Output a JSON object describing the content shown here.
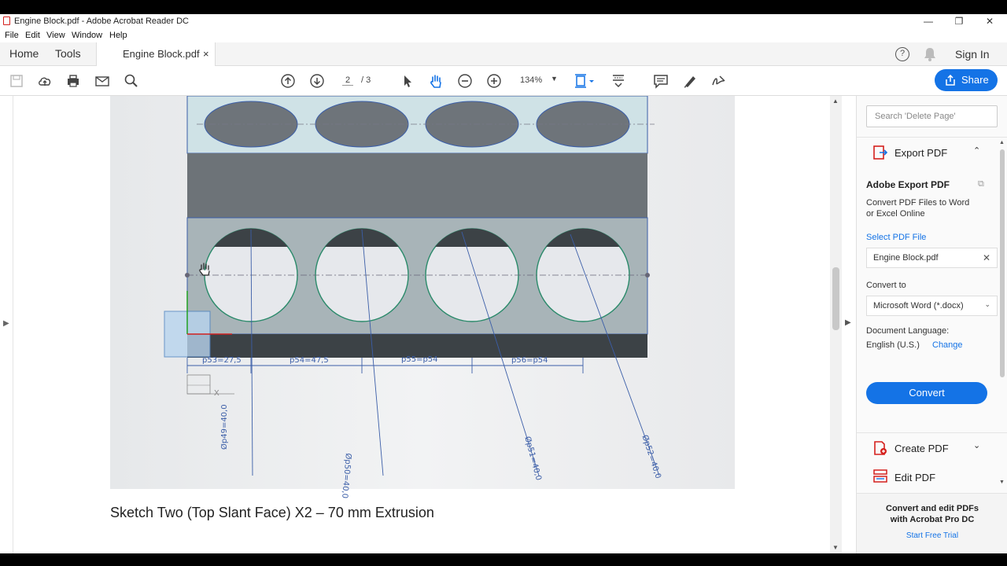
{
  "window": {
    "title": "Engine Block.pdf - Adobe Acrobat Reader DC",
    "minimize": "—",
    "restore": "❐",
    "close": "✕"
  },
  "menu": [
    "File",
    "Edit",
    "View",
    "Window",
    "Help"
  ],
  "tabs": {
    "home": "Home",
    "tools": "Tools",
    "document": "Engine Block.pdf",
    "close": "×"
  },
  "header_right": {
    "sign_in": "Sign In"
  },
  "toolbar": {
    "page_current": "2",
    "page_total": "/ 3",
    "zoom": "134%",
    "share": "Share"
  },
  "document": {
    "caption": "Sketch Two (Top Slant Face) X2 – 70 mm Extrusion",
    "dimensions": [
      "p53=27,5",
      "p54=47,5",
      "p55=p54",
      "p56=p54"
    ],
    "diameters": [
      "Øp49=40,0",
      "Øp50=40,0",
      "Øp51=40,0",
      "Øp52=40,0"
    ],
    "axis_x": "X"
  },
  "right_pane": {
    "search_placeholder": "Search 'Delete Page'",
    "export_title": "Export PDF",
    "adobe_export_title": "Adobe Export PDF",
    "description_line1": "Convert PDF Files to Word",
    "description_line2": "or Excel Online",
    "select_file": "Select PDF File",
    "file_name": "Engine Block.pdf",
    "convert_to": "Convert to",
    "format": "Microsoft Word (*.docx)",
    "doc_lang_label": "Document Language:",
    "doc_lang": "English (U.S.)",
    "change": "Change",
    "convert_button": "Convert",
    "create_pdf": "Create PDF",
    "edit_pdf": "Edit PDF",
    "promo_line1": "Convert and edit PDFs",
    "promo_line2": "with Acrobat Pro DC",
    "free_trial": "Start Free Trial"
  },
  "colors": {
    "accent": "#1473e6",
    "pdf_red": "#d4201d"
  }
}
